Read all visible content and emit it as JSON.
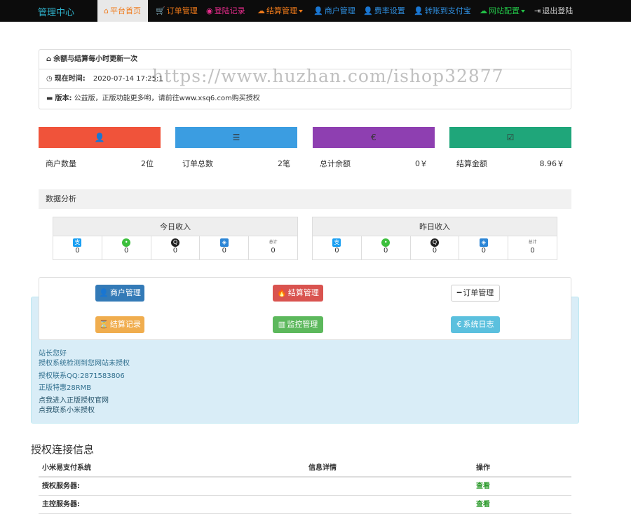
{
  "nav": {
    "brand": "管理中心",
    "items": [
      {
        "icon": "home-icon",
        "glyph": "⌂",
        "label": "平台首页",
        "color": "#f07a1a",
        "active": true
      },
      {
        "icon": "cart-icon",
        "glyph": "🛒",
        "label": "订单管理",
        "color": "#f07a1a"
      },
      {
        "icon": "camera-icon",
        "glyph": "◉",
        "label": "登陆记录",
        "color": "#ec2d8f"
      },
      {
        "icon": "cloud-icon",
        "glyph": "☁",
        "label": "结算管理",
        "color": "#f07a1a",
        "dropdown": true
      },
      {
        "icon": "user-icon",
        "glyph": "👤",
        "label": "商户管理",
        "color": "#2f8fe0"
      },
      {
        "icon": "user-icon",
        "glyph": "👤",
        "label": "费率设置",
        "color": "#2f8fe0"
      },
      {
        "icon": "user-icon",
        "glyph": "👤",
        "label": "转账到支付宝",
        "color": "#2f8fe0"
      },
      {
        "icon": "cloud-icon",
        "glyph": "☁",
        "label": "网站配置",
        "color": "#22c247",
        "dropdown": true
      },
      {
        "icon": "logout-icon",
        "glyph": "⇥",
        "label": "退出登陆",
        "color": "#cccccc"
      }
    ]
  },
  "info": {
    "heading": "余额与结算每小时更新一次",
    "time_label": "现在时间:",
    "time_value": "2020-07-14 17:25:1",
    "version_label": "版本:",
    "version_value": "公益版，正版功能更多哟，请前往www.xsq6.com购买授权"
  },
  "watermark": "https://www.huzhan.com/ishop32877",
  "stats": [
    {
      "icon": "user-icon",
      "glyph": "👤",
      "label": "商户数量",
      "value": "2位",
      "color": "#f0533a"
    },
    {
      "icon": "list-icon",
      "glyph": "☰",
      "label": "订单总数",
      "value": "2笔",
      "color": "#3b9de1"
    },
    {
      "icon": "euro-icon",
      "glyph": "€",
      "label": "总计余额",
      "value": "0￥",
      "color": "#8e3fb1"
    },
    {
      "icon": "check-icon",
      "glyph": "☑",
      "label": "结算金额",
      "value": "8.96￥",
      "color": "#1fa67a"
    }
  ],
  "analysis_title": "数据分析",
  "income": [
    {
      "title": "今日收入",
      "values": [
        "0",
        "0",
        "0",
        "0",
        "0"
      ]
    },
    {
      "title": "昨日收入",
      "values": [
        "0",
        "0",
        "0",
        "0",
        "0"
      ]
    }
  ],
  "pay_methods": [
    {
      "icon": "alipay-icon",
      "glyph": "支",
      "color": "#1a9ff2"
    },
    {
      "icon": "wechat-icon",
      "glyph": "•",
      "color": "#3cbf3c"
    },
    {
      "icon": "qq-icon",
      "glyph": "Q",
      "color": "#222222"
    },
    {
      "icon": "shield-icon",
      "glyph": "◈",
      "color": "#2d86d6"
    },
    {
      "icon": "total-icon",
      "glyph": "总计",
      "color": "#555555"
    }
  ],
  "buttons": [
    {
      "name": "merchant",
      "glyph": "👤",
      "label": "商户管理",
      "bg": "#337ab7"
    },
    {
      "name": "settlement",
      "glyph": "🔥",
      "label": "结算管理",
      "bg": "#d9534f"
    },
    {
      "name": "order",
      "glyph": "━",
      "label": "订单管理",
      "bg": "#ffffff"
    },
    {
      "name": "settle-record",
      "glyph": "⏳",
      "label": "结算记录",
      "bg": "#f0ad4e"
    },
    {
      "name": "monitor",
      "glyph": "▥",
      "label": "监控管理",
      "bg": "#5cb85c"
    },
    {
      "name": "system-log",
      "glyph": "€",
      "label": "系统日志",
      "bg": "#5bc0de"
    }
  ],
  "notice": {
    "greeting": "站长您好",
    "line1": "授权系统检测到您网站未授权",
    "line2": "授权联系QQ:2871583806",
    "line3": "正版特惠28RMB",
    "link1": "点我进入正版授权官网",
    "link2": "点我联系小米授权"
  },
  "auth": {
    "title": "授权连接信息",
    "columns": [
      "小米易支付系统",
      "信息详情",
      "操作"
    ],
    "rows": [
      {
        "label": "授权服务器:",
        "action": "查看"
      },
      {
        "label": "主控服务器:",
        "action": "查看"
      }
    ]
  }
}
